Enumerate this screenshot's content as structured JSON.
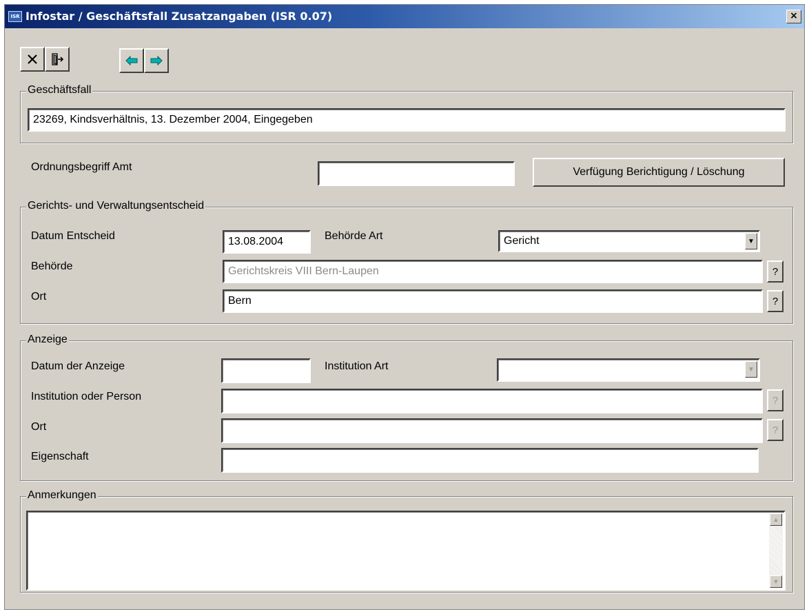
{
  "window": {
    "title": "Infostar / Geschäftsfall Zusatzangaben (ISR 0.07)",
    "close_glyph": "×",
    "app_icon_text": "ISR"
  },
  "toolbar": {
    "cancel_icon": "close-x-icon",
    "exit_icon": "exit-door-icon",
    "back_icon": "arrow-left-icon",
    "forward_icon": "arrow-right-icon",
    "arrow_color": "#00a0a0"
  },
  "geschaeftsfall": {
    "legend": "Geschäftsfall",
    "value": "23269, Kindsverhältnis, 13. Dezember 2004, Eingegeben"
  },
  "ordnung": {
    "label": "Ordnungsbegriff Amt",
    "value": "",
    "button_label": "Verfügung Berichtigung / Löschung"
  },
  "entscheid": {
    "legend": "Gerichts- und Verwaltungsentscheid",
    "datum_label": "Datum Entscheid",
    "datum_value": "13.08.2004",
    "behoerde_art_label": "Behörde Art",
    "behoerde_art_value": "Gericht",
    "behoerde_label": "Behörde",
    "behoerde_value": "Gerichtskreis VIII Bern-Laupen",
    "ort_label": "Ort",
    "ort_value": "Bern",
    "lookup": "?"
  },
  "anzeige": {
    "legend": "Anzeige",
    "datum_label": "Datum der Anzeige",
    "datum_value": "",
    "institution_art_label": "Institution Art",
    "institution_art_value": "",
    "institution_label": "Institution oder Person",
    "institution_value": "",
    "ort_label": "Ort",
    "ort_value": "",
    "eigenschaft_label": "Eigenschaft",
    "eigenschaft_value": "",
    "lookup": "?"
  },
  "anmerkungen": {
    "legend": "Anmerkungen",
    "value": ""
  }
}
